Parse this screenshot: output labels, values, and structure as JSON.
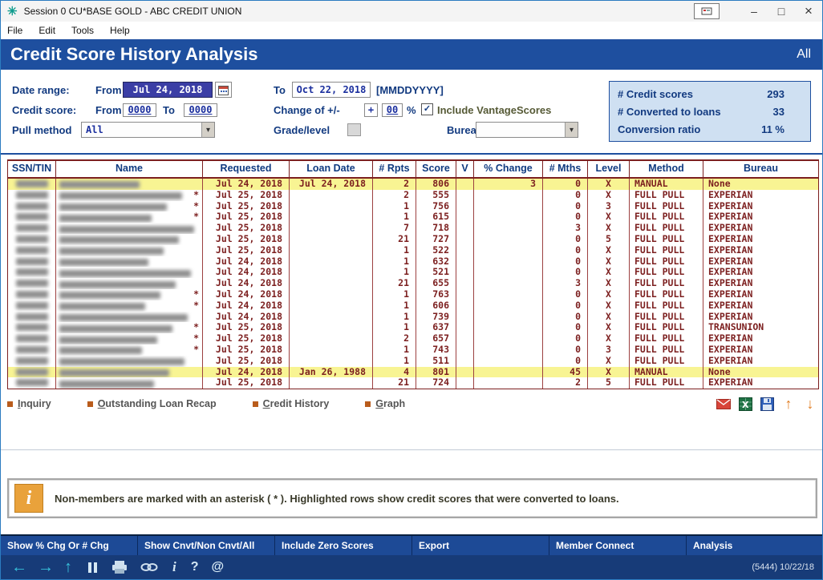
{
  "window": {
    "title": "Session 0 CU*BASE GOLD - ABC CREDIT UNION",
    "controls": {
      "minimize": "–",
      "maximize": "□",
      "close": "×"
    }
  },
  "menu": {
    "items": [
      "File",
      "Edit",
      "Tools",
      "Help"
    ]
  },
  "header": {
    "title": "Credit Score History Analysis",
    "right_label": "All"
  },
  "filters": {
    "date_range_label": "Date range:",
    "from_label": "From",
    "to_label": "To",
    "date_from_value": "Jul 24, 2018",
    "date_to_value": "Oct 22, 2018",
    "date_format_hint": "[MMDDYYYY]",
    "credit_score_label": "Credit score:",
    "credit_from_value": "0000",
    "credit_to_value": "0000",
    "change_label": "Change of +/-",
    "change_sign_value": "+",
    "change_amount_value": "00",
    "percent_sign": "%",
    "include_vantage_label": "Include VantageScores",
    "include_vantage_checked": true,
    "pull_method_label": "Pull method",
    "pull_method_value": "All",
    "grade_level_label": "Grade/level",
    "grade_level_value": "",
    "bureau_label": "Bureau",
    "bureau_value": ""
  },
  "summary": {
    "items": [
      {
        "label": "# Credit scores",
        "value": "293"
      },
      {
        "label": "# Converted to loans",
        "value": "33"
      },
      {
        "label": "Conversion ratio",
        "value": "11 %"
      }
    ]
  },
  "table": {
    "columns": [
      "SSN/TIN",
      "Name",
      "Requested",
      "Loan Date",
      "# Rpts",
      "Score",
      "V",
      "% Change",
      "# Mths",
      "Level",
      "Method",
      "Bureau"
    ],
    "rows": [
      {
        "asterisk": "",
        "requested": "Jul 24, 2018",
        "loan_date": "Jul 24, 2018",
        "rpts": "2",
        "score": "806",
        "v": "",
        "pct_change": "3",
        "mths": "0",
        "level": "X",
        "method": "MANUAL",
        "bureau": "None",
        "highlight": true
      },
      {
        "asterisk": "*",
        "requested": "Jul 25, 2018",
        "loan_date": "",
        "rpts": "2",
        "score": "555",
        "v": "",
        "pct_change": "",
        "mths": "0",
        "level": "X",
        "method": "FULL PULL",
        "bureau": "EXPERIAN",
        "highlight": false
      },
      {
        "asterisk": "*",
        "requested": "Jul 25, 2018",
        "loan_date": "",
        "rpts": "1",
        "score": "756",
        "v": "",
        "pct_change": "",
        "mths": "0",
        "level": "3",
        "method": "FULL PULL",
        "bureau": "EXPERIAN",
        "highlight": false
      },
      {
        "asterisk": "*",
        "requested": "Jul 25, 2018",
        "loan_date": "",
        "rpts": "1",
        "score": "615",
        "v": "",
        "pct_change": "",
        "mths": "0",
        "level": "X",
        "method": "FULL PULL",
        "bureau": "EXPERIAN",
        "highlight": false
      },
      {
        "asterisk": "",
        "requested": "Jul 25, 2018",
        "loan_date": "",
        "rpts": "7",
        "score": "718",
        "v": "",
        "pct_change": "",
        "mths": "3",
        "level": "X",
        "method": "FULL PULL",
        "bureau": "EXPERIAN",
        "highlight": false
      },
      {
        "asterisk": "",
        "requested": "Jul 25, 2018",
        "loan_date": "",
        "rpts": "21",
        "score": "727",
        "v": "",
        "pct_change": "",
        "mths": "0",
        "level": "5",
        "method": "FULL PULL",
        "bureau": "EXPERIAN",
        "highlight": false
      },
      {
        "asterisk": "",
        "requested": "Jul 25, 2018",
        "loan_date": "",
        "rpts": "1",
        "score": "522",
        "v": "",
        "pct_change": "",
        "mths": "0",
        "level": "X",
        "method": "FULL PULL",
        "bureau": "EXPERIAN",
        "highlight": false
      },
      {
        "asterisk": "",
        "requested": "Jul 24, 2018",
        "loan_date": "",
        "rpts": "1",
        "score": "632",
        "v": "",
        "pct_change": "",
        "mths": "0",
        "level": "X",
        "method": "FULL PULL",
        "bureau": "EXPERIAN",
        "highlight": false
      },
      {
        "asterisk": "",
        "requested": "Jul 24, 2018",
        "loan_date": "",
        "rpts": "1",
        "score": "521",
        "v": "",
        "pct_change": "",
        "mths": "0",
        "level": "X",
        "method": "FULL PULL",
        "bureau": "EXPERIAN",
        "highlight": false
      },
      {
        "asterisk": "",
        "requested": "Jul 24, 2018",
        "loan_date": "",
        "rpts": "21",
        "score": "655",
        "v": "",
        "pct_change": "",
        "mths": "3",
        "level": "X",
        "method": "FULL PULL",
        "bureau": "EXPERIAN",
        "highlight": false
      },
      {
        "asterisk": "*",
        "requested": "Jul 24, 2018",
        "loan_date": "",
        "rpts": "1",
        "score": "763",
        "v": "",
        "pct_change": "",
        "mths": "0",
        "level": "X",
        "method": "FULL PULL",
        "bureau": "EXPERIAN",
        "highlight": false
      },
      {
        "asterisk": "*",
        "requested": "Jul 24, 2018",
        "loan_date": "",
        "rpts": "1",
        "score": "606",
        "v": "",
        "pct_change": "",
        "mths": "0",
        "level": "X",
        "method": "FULL PULL",
        "bureau": "EXPERIAN",
        "highlight": false
      },
      {
        "asterisk": "",
        "requested": "Jul 24, 2018",
        "loan_date": "",
        "rpts": "1",
        "score": "739",
        "v": "",
        "pct_change": "",
        "mths": "0",
        "level": "X",
        "method": "FULL PULL",
        "bureau": "EXPERIAN",
        "highlight": false
      },
      {
        "asterisk": "*",
        "requested": "Jul 25, 2018",
        "loan_date": "",
        "rpts": "1",
        "score": "637",
        "v": "",
        "pct_change": "",
        "mths": "0",
        "level": "X",
        "method": "FULL PULL",
        "bureau": "TRANSUNION",
        "highlight": false
      },
      {
        "asterisk": "*",
        "requested": "Jul 25, 2018",
        "loan_date": "",
        "rpts": "2",
        "score": "657",
        "v": "",
        "pct_change": "",
        "mths": "0",
        "level": "X",
        "method": "FULL PULL",
        "bureau": "EXPERIAN",
        "highlight": false
      },
      {
        "asterisk": "*",
        "requested": "Jul 25, 2018",
        "loan_date": "",
        "rpts": "1",
        "score": "743",
        "v": "",
        "pct_change": "",
        "mths": "0",
        "level": "3",
        "method": "FULL PULL",
        "bureau": "EXPERIAN",
        "highlight": false
      },
      {
        "asterisk": "",
        "requested": "Jul 25, 2018",
        "loan_date": "",
        "rpts": "1",
        "score": "511",
        "v": "",
        "pct_change": "",
        "mths": "0",
        "level": "X",
        "method": "FULL PULL",
        "bureau": "EXPERIAN",
        "highlight": false
      },
      {
        "asterisk": "",
        "requested": "Jul 24, 2018",
        "loan_date": "Jan 26, 1988",
        "rpts": "4",
        "score": "801",
        "v": "",
        "pct_change": "",
        "mths": "45",
        "level": "X",
        "method": "MANUAL",
        "bureau": "None",
        "highlight": true
      },
      {
        "asterisk": "",
        "requested": "Jul 25, 2018",
        "loan_date": "",
        "rpts": "21",
        "score": "724",
        "v": "",
        "pct_change": "",
        "mths": "2",
        "level": "5",
        "method": "FULL PULL",
        "bureau": "EXPERIAN",
        "highlight": false
      }
    ]
  },
  "actions": {
    "buttons": [
      "Inquiry",
      "Outstanding Loan Recap",
      "Credit History",
      "Graph"
    ],
    "export_icons": [
      "pdf-export-icon",
      "excel-export-icon",
      "save-disk-icon",
      "scroll-up-icon",
      "scroll-down-icon"
    ]
  },
  "notice": {
    "text": "Non-members are marked with an asterisk ( * ).  Highlighted rows show credit scores that were converted to loans."
  },
  "function_bar": {
    "items": [
      "Show % Chg Or # Chg",
      "Show Cnvt/Non Cnvt/All",
      "Include Zero Scores",
      "Export",
      "Member Connect",
      "Analysis"
    ]
  },
  "toolbar": {
    "icons": [
      "back-arrow-icon",
      "forward-arrow-icon",
      "up-arrow-icon",
      "pause-icon",
      "printer-icon",
      "link-icon",
      "info-icon",
      "help-icon",
      "email-at-icon"
    ],
    "session_info": "(5444) 10/22/18"
  },
  "colors": {
    "header_blue": "#1e4f9f",
    "table_text_maroon": "#7c1f1f",
    "highlight_yellow": "#f8f493",
    "summary_bg": "#cfe0f2",
    "accent_orange": "#e07b1f"
  }
}
